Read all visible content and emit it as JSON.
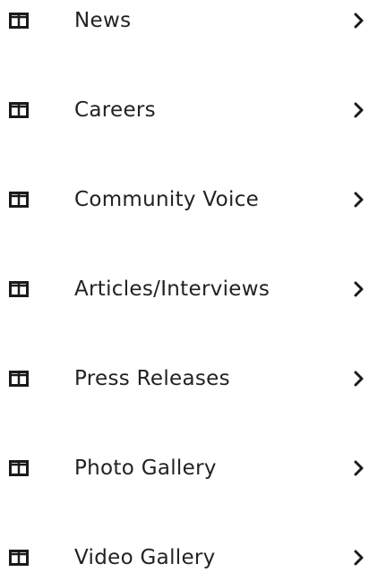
{
  "menu": {
    "items": [
      {
        "label": "News",
        "icon": "columns-icon"
      },
      {
        "label": "Careers",
        "icon": "columns-icon"
      },
      {
        "label": "Community Voice",
        "icon": "columns-icon"
      },
      {
        "label": "Articles/Interviews",
        "icon": "columns-icon"
      },
      {
        "label": "Press Releases",
        "icon": "columns-icon"
      },
      {
        "label": "Photo Gallery",
        "icon": "columns-icon"
      },
      {
        "label": "Video Gallery",
        "icon": "columns-icon"
      }
    ],
    "chevron_icon": "chevron-right-icon"
  },
  "colors": {
    "text": "#222222",
    "icon": "#1a1a1a",
    "background": "#ffffff"
  }
}
